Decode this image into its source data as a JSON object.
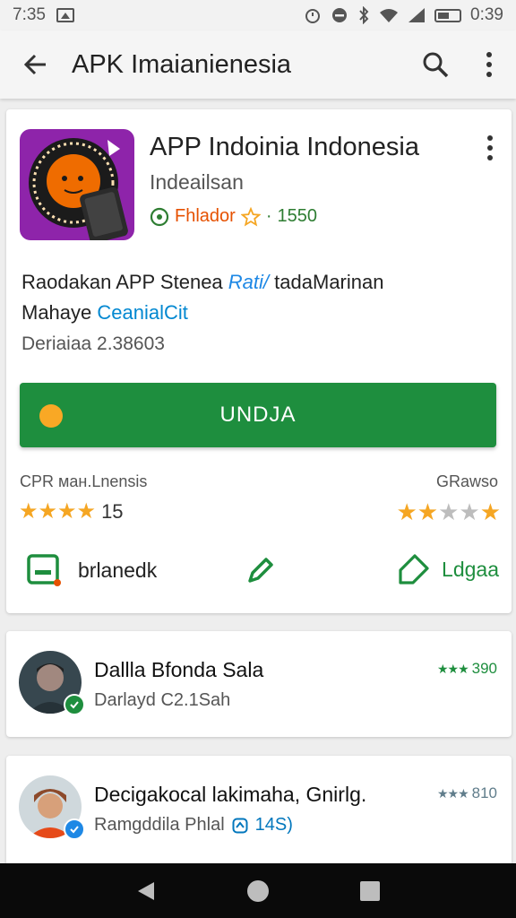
{
  "status_bar": {
    "time": "7:35",
    "clock": "0:39"
  },
  "app_bar": {
    "title": "APK Imaianienesia"
  },
  "app": {
    "name": "APP Indoinia Indonesia",
    "developer": "Indeailsan",
    "badge_text": "Fhlador",
    "rating_count": "1550",
    "desc_line1_a": "Raodakan APP Stenea",
    "desc_line1_b": "Rati/",
    "desc_line1_c": "tadaMarinan",
    "desc_line2_a": "Mahaye",
    "desc_line2_b": "CeanialCit",
    "version": "Deriaiaa 2.38603",
    "install_label": "UNDJA",
    "rating_left_label": "CPR ман.Lnensis",
    "rating_left_count": "15",
    "rating_left_stars": 3.5,
    "rating_right_label": "GRawso",
    "rating_right_stars": 2.5,
    "action_left_label": "brlanedk",
    "action_right_label": "Ldgaa"
  },
  "reviews": [
    {
      "name": "Dallla Bfonda Sala",
      "subtitle": "Darlayd C2.1Sah",
      "tag": "",
      "score": "390"
    },
    {
      "name": "Decigakocal lakimaha, Gnirlg.",
      "subtitle": "Ramgddila Phlal",
      "tag": "14S)",
      "score": "810"
    }
  ],
  "colors": {
    "accent_green": "#1e8e3e",
    "star": "#f5a623",
    "app_icon_bg": "#8e24aa"
  },
  "icons": {
    "back": "arrow-back-icon",
    "search": "search-icon",
    "more": "more-vert-icon",
    "nav_back": "triangle-back-icon",
    "nav_home": "circle-home-icon",
    "nav_recents": "square-recents-icon"
  }
}
